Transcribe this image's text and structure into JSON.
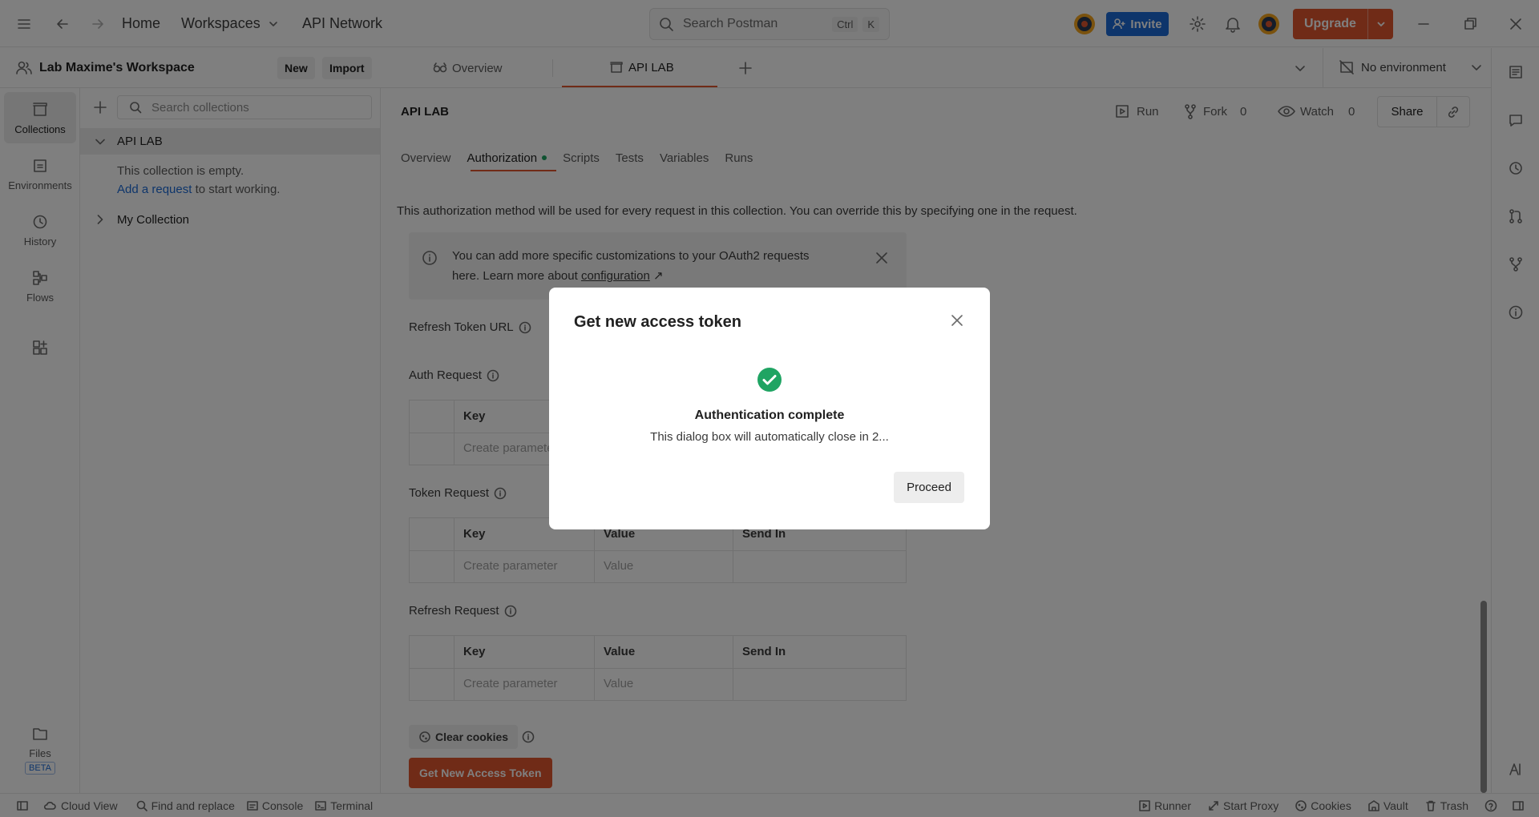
{
  "topbar": {
    "home": "Home",
    "workspaces": "Workspaces",
    "api_network": "API Network",
    "search_placeholder": "Search Postman",
    "kbd_ctrl": "Ctrl",
    "kbd_k": "K",
    "invite": "Invite",
    "upgrade": "Upgrade"
  },
  "workspace": {
    "name": "Lab Maxime's Workspace",
    "new": "New",
    "import": "Import"
  },
  "tabs": [
    {
      "label": "Overview"
    },
    {
      "label": "API LAB"
    }
  ],
  "environment": "No environment",
  "leftnav": {
    "items": [
      {
        "label": "Collections",
        "icon": "collections-icon"
      },
      {
        "label": "Environments",
        "icon": "environments-icon"
      },
      {
        "label": "History",
        "icon": "history-icon"
      },
      {
        "label": "Flows",
        "icon": "flows-icon"
      }
    ],
    "files": "Files",
    "beta": "BETA"
  },
  "sidebar": {
    "search_placeholder": "Search collections",
    "collection": "API LAB",
    "empty_text": "This collection is empty.",
    "add_request": "Add a request",
    "start_text": "to start working.",
    "my_collection": "My Collection"
  },
  "main": {
    "title": "API LAB",
    "run": "Run",
    "fork": "Fork",
    "fork_count": "0",
    "watch": "Watch",
    "watch_count": "0",
    "share": "Share",
    "subtabs": [
      "Overview",
      "Authorization",
      "Scripts",
      "Tests",
      "Variables",
      "Runs"
    ],
    "description": "This authorization method will be used for every request in this collection. You can override this by specifying one in the request.",
    "banner_line1": "You can add more specific customizations to your OAuth2 requests",
    "banner_line2_prefix": "here. Learn more about ",
    "banner_link": "configuration",
    "banner_arrow": "↗",
    "refresh_token_url": "Refresh Token URL",
    "auth_request": "Auth Request",
    "token_request": "Token Request",
    "refresh_request": "Refresh Request",
    "col_key": "Key",
    "col_value": "Value",
    "col_send_in": "Send In",
    "create_parameter": "Create parameter",
    "value_placeholder": "Value",
    "clear_cookies": "Clear cookies",
    "get_token": "Get New Access Token"
  },
  "statusbar": {
    "cloud_view": "Cloud View",
    "find_replace": "Find and replace",
    "console": "Console",
    "terminal": "Terminal",
    "runner": "Runner",
    "start_proxy": "Start Proxy",
    "cookies": "Cookies",
    "vault": "Vault",
    "trash": "Trash"
  },
  "dialog": {
    "title": "Get new access token",
    "status": "Authentication complete",
    "message": "This dialog box will automatically close in 2...",
    "proceed": "Proceed"
  },
  "colors": {
    "accent": "#e1572f",
    "invite": "#1c6bd6",
    "success": "#1fa463",
    "link": "#1c6bd6"
  }
}
